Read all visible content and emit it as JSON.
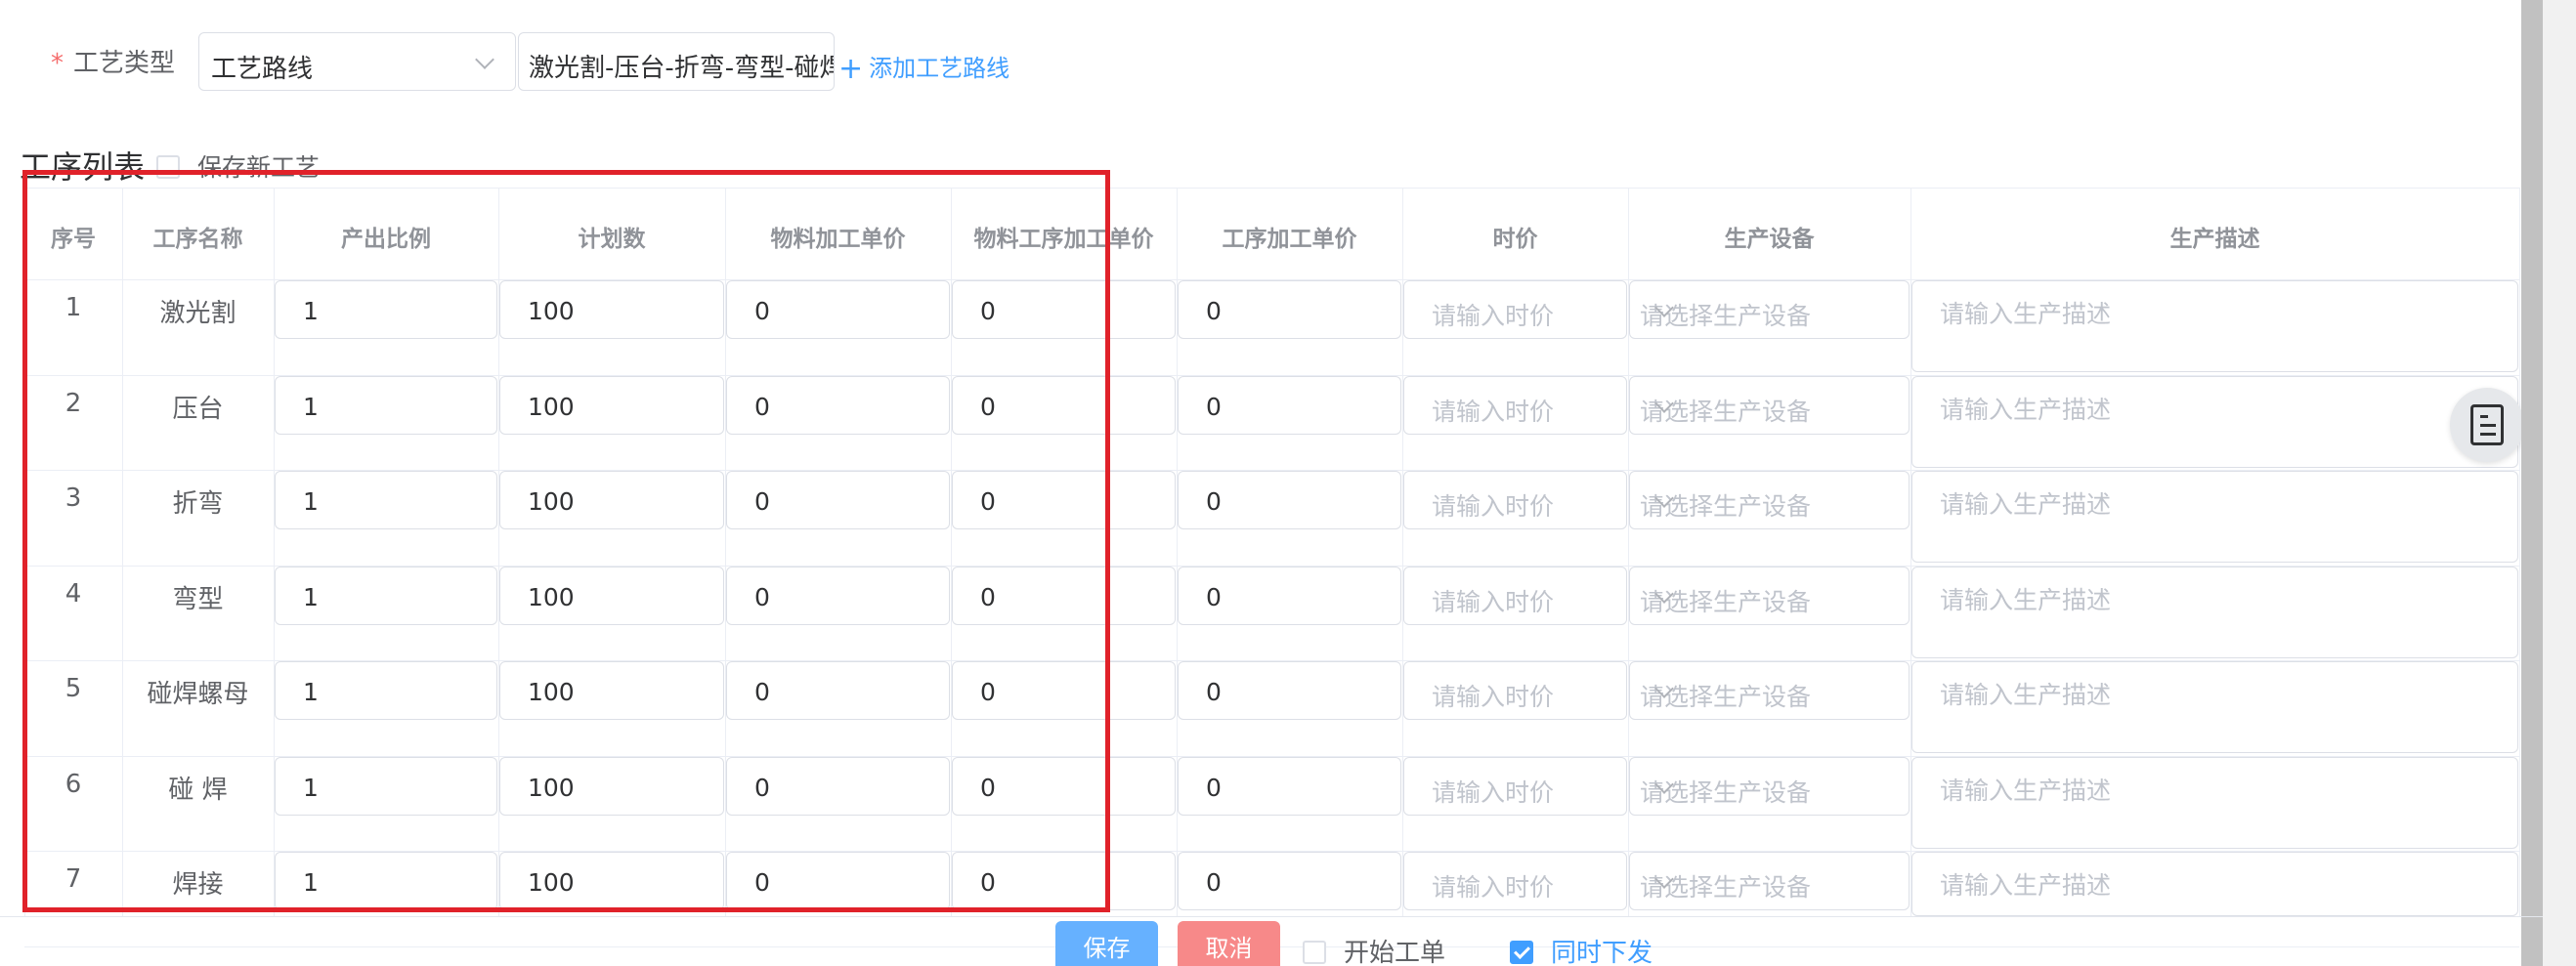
{
  "form": {
    "process_type_label": "工艺类型",
    "process_type_value": "工艺路线",
    "route_value": "激光割-压台-折弯-弯型-碰焊螺母-碰 焊-焊接",
    "add_route_label": "添加工艺路线"
  },
  "section": {
    "title": "工序列表",
    "save_new_label": "保存新工艺"
  },
  "table": {
    "columns": [
      "序号",
      "工序名称",
      "产出比例",
      "计划数",
      "物料加工单价",
      "物料工序加工单价",
      "工序加工单价",
      "时价",
      "生产设备",
      "生产描述"
    ],
    "placeholders": {
      "hourly_price": "请输入时价",
      "equipment": "请选择生产设备",
      "description": "请输入生产描述"
    },
    "rows": [
      {
        "seq": "1",
        "name": "激光割",
        "ratio": "1",
        "plan": "100",
        "material_price": "0",
        "material_process_price": "0",
        "process_price": "0"
      },
      {
        "seq": "2",
        "name": "压台",
        "ratio": "1",
        "plan": "100",
        "material_price": "0",
        "material_process_price": "0",
        "process_price": "0"
      },
      {
        "seq": "3",
        "name": "折弯",
        "ratio": "1",
        "plan": "100",
        "material_price": "0",
        "material_process_price": "0",
        "process_price": "0"
      },
      {
        "seq": "4",
        "name": "弯型",
        "ratio": "1",
        "plan": "100",
        "material_price": "0",
        "material_process_price": "0",
        "process_price": "0"
      },
      {
        "seq": "5",
        "name": "碰焊螺母",
        "ratio": "1",
        "plan": "100",
        "material_price": "0",
        "material_process_price": "0",
        "process_price": "0"
      },
      {
        "seq": "6",
        "name": "碰 焊",
        "ratio": "1",
        "plan": "100",
        "material_price": "0",
        "material_process_price": "0",
        "process_price": "0"
      },
      {
        "seq": "7",
        "name": "焊接",
        "ratio": "1",
        "plan": "100",
        "material_price": "0",
        "material_process_price": "0",
        "process_price": "0"
      }
    ]
  },
  "footer": {
    "save_label": "保存",
    "cancel_label": "取消",
    "start_order_label": "开始工单",
    "start_order_checked": false,
    "issue_together_label": "同时下发",
    "issue_together_checked": true
  },
  "colors": {
    "primary": "#409eff",
    "danger": "#f56c6c",
    "annotation": "#e0222a"
  },
  "icons": {
    "floating_button": "document-list-icon",
    "select_arrow": "chevron-down-icon",
    "add": "plus-icon"
  }
}
